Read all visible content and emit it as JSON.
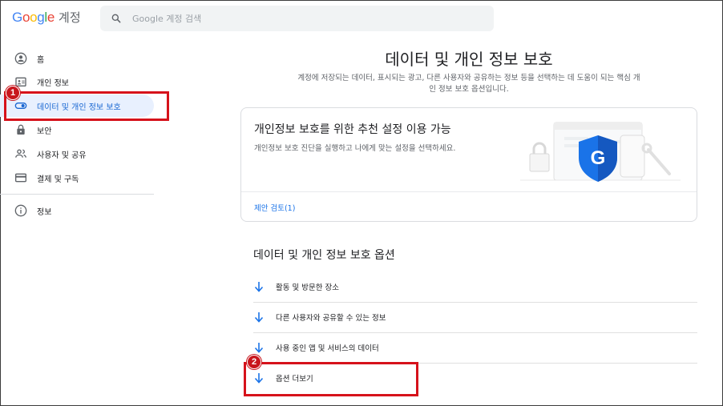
{
  "header": {
    "logo_letters": [
      {
        "ch": "G",
        "color": "#4285F4"
      },
      {
        "ch": "o",
        "color": "#EA4335"
      },
      {
        "ch": "o",
        "color": "#FBBC05"
      },
      {
        "ch": "g",
        "color": "#4285F4"
      },
      {
        "ch": "l",
        "color": "#34A853"
      },
      {
        "ch": "e",
        "color": "#EA4335"
      }
    ],
    "account_label": "계정",
    "search_placeholder": "Google 계정 검색"
  },
  "sidebar": {
    "items": [
      {
        "label": "홈",
        "icon": "account-circle-icon"
      },
      {
        "label": "개인 정보",
        "icon": "id-card-icon"
      },
      {
        "label": "데이터 및 개인 정보 보호",
        "icon": "toggle-icon",
        "active": true
      },
      {
        "label": "보안",
        "icon": "lock-icon"
      },
      {
        "label": "사용자 및 공유",
        "icon": "people-icon"
      },
      {
        "label": "결제 및 구독",
        "icon": "credit-card-icon"
      },
      {
        "label": "정보",
        "icon": "info-icon"
      }
    ]
  },
  "callouts": {
    "badge1": "1",
    "badge2": "2",
    "color": "#d6121b"
  },
  "main": {
    "title": "데이터 및 개인 정보 보호",
    "description": "계정에 저장되는 데이터, 표시되는 광고, 다른 사용자와 공유하는 정보 등을 선택하는 데 도움이 되는 핵심 개인 정보 보호 옵션입니다.",
    "card": {
      "title": "개인정보 보호를 위한 추천 설정 이용 가능",
      "description": "개인정보 보호 진단을 실행하고 나에게 맞는 설정을 선택하세요.",
      "link": "제안 검토(1)",
      "shield_letter": "G",
      "shield_color": "#1a73e8"
    },
    "options_title": "데이터 및 개인 정보 보호 옵션",
    "options": [
      {
        "label": "활동 및 방문한 장소"
      },
      {
        "label": "다른 사용자와 공유할 수 있는 정보"
      },
      {
        "label": "사용 중인 앱 및 서비스의 데이터"
      },
      {
        "label": "옵션 더보기"
      }
    ],
    "accent_color": "#1a73e8"
  }
}
